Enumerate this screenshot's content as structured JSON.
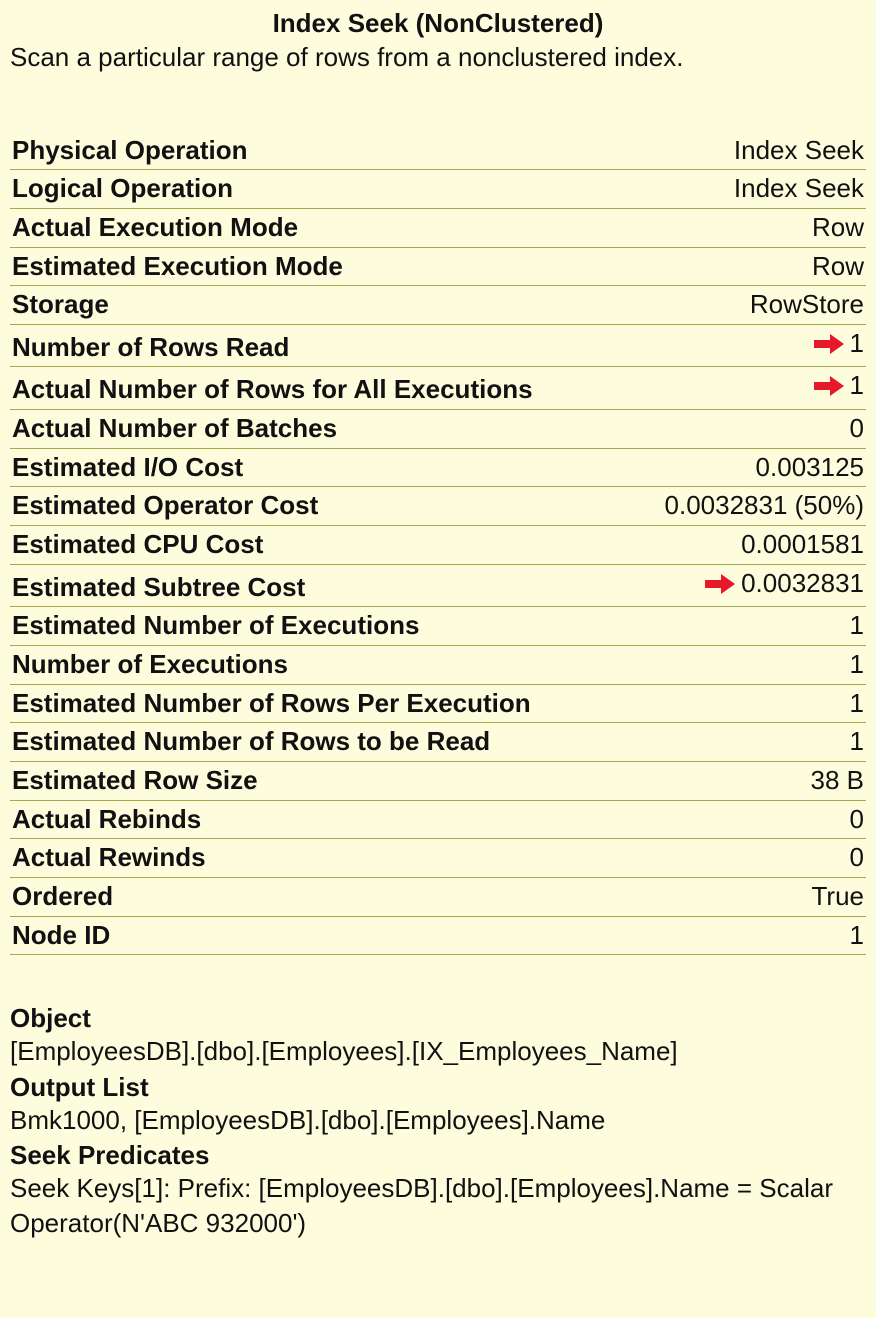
{
  "header": {
    "title": "Index Seek (NonClustered)",
    "subtitle": "Scan a particular range of rows from a nonclustered index."
  },
  "rows": [
    {
      "label": "Physical Operation",
      "value": "Index Seek",
      "arrow": false
    },
    {
      "label": "Logical Operation",
      "value": "Index Seek",
      "arrow": false
    },
    {
      "label": "Actual Execution Mode",
      "value": "Row",
      "arrow": false
    },
    {
      "label": "Estimated Execution Mode",
      "value": "Row",
      "arrow": false
    },
    {
      "label": "Storage",
      "value": "RowStore",
      "arrow": false
    },
    {
      "label": "Number of Rows Read",
      "value": "1",
      "arrow": true
    },
    {
      "label": "Actual Number of Rows for All Executions",
      "value": "1",
      "arrow": true
    },
    {
      "label": "Actual Number of Batches",
      "value": "0",
      "arrow": false
    },
    {
      "label": "Estimated I/O Cost",
      "value": "0.003125",
      "arrow": false
    },
    {
      "label": "Estimated Operator Cost",
      "value": "0.0032831 (50%)",
      "arrow": false
    },
    {
      "label": "Estimated CPU Cost",
      "value": "0.0001581",
      "arrow": false
    },
    {
      "label": "Estimated Subtree Cost",
      "value": "0.0032831",
      "arrow": true
    },
    {
      "label": "Estimated Number of Executions",
      "value": "1",
      "arrow": false
    },
    {
      "label": "Number of Executions",
      "value": "1",
      "arrow": false
    },
    {
      "label": "Estimated Number of Rows Per Execution",
      "value": "1",
      "arrow": false
    },
    {
      "label": "Estimated Number of Rows to be Read",
      "value": "1",
      "arrow": false
    },
    {
      "label": "Estimated Row Size",
      "value": "38 B",
      "arrow": false
    },
    {
      "label": "Actual Rebinds",
      "value": "0",
      "arrow": false
    },
    {
      "label": "Actual Rewinds",
      "value": "0",
      "arrow": false
    },
    {
      "label": "Ordered",
      "value": "True",
      "arrow": false
    },
    {
      "label": "Node ID",
      "value": "1",
      "arrow": false
    }
  ],
  "sections": [
    {
      "label": "Object",
      "value": "[EmployeesDB].[dbo].[Employees].[IX_Employees_Name]"
    },
    {
      "label": "Output List",
      "value": "Bmk1000, [EmployeesDB].[dbo].[Employees].Name"
    },
    {
      "label": "Seek Predicates",
      "value": "Seek Keys[1]: Prefix: [EmployeesDB].[dbo].[Employees].Name = Scalar Operator(N'ABC 932000')"
    }
  ]
}
